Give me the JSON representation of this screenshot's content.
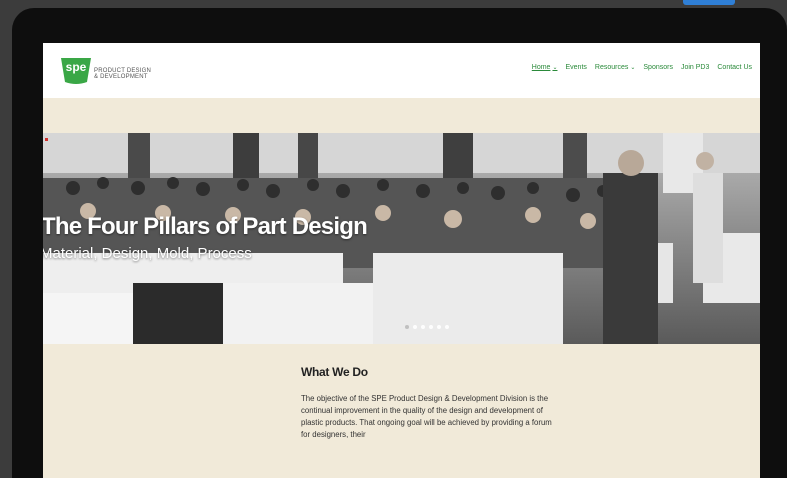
{
  "header": {
    "logo_mark": "spe",
    "logo_line1": "PRODUCT DESIGN",
    "logo_line2": "& DEVELOPMENT",
    "nav": [
      {
        "label": "Home",
        "dropdown": true,
        "active": true
      },
      {
        "label": "Events",
        "dropdown": false
      },
      {
        "label": "Resources",
        "dropdown": true
      },
      {
        "label": "Sponsors",
        "dropdown": false
      },
      {
        "label": "Join PD3",
        "dropdown": false
      },
      {
        "label": "Contact Us",
        "dropdown": false
      }
    ]
  },
  "hero": {
    "title": "The Four Pillars of Part Design",
    "subtitle": "Material, Design, Mold, Process",
    "slide_count": 6,
    "active_slide": 0
  },
  "content": {
    "heading": "What We Do",
    "body": "The objective of the SPE Product Design & Development Division is the continual improvement in the quality of the design and development of plastic products. That ongoing goal will be achieved by providing a forum for designers, their"
  },
  "colors": {
    "brand_green": "#3aa746",
    "nav_green": "#2a8a3a",
    "page_bg": "#f1ead9"
  }
}
